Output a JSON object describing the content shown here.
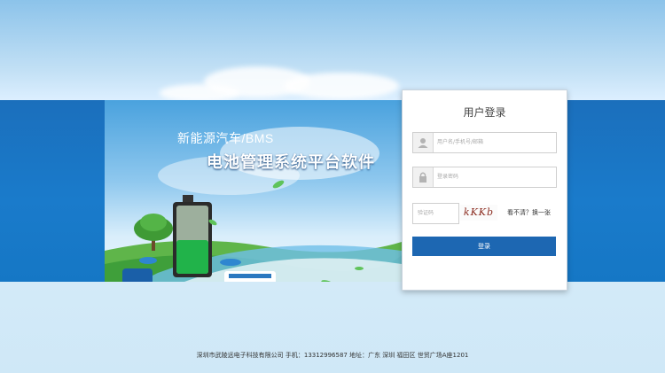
{
  "banner": {
    "subtitle": "新能源汽车/BMS",
    "title": "电池管理系统平台软件"
  },
  "login": {
    "title": "用户登录",
    "username_placeholder": "用户名/手机号/邮箱",
    "password_placeholder": "登录密码",
    "captcha_placeholder": "验证码",
    "captcha_text": "kKKb",
    "refresh_label": "看不清？换一张",
    "submit_label": "登录"
  },
  "footer": {
    "text": "深圳市武陵远电子科技有限公司 手机：13312996587 地址：广东 深圳 福田区 世贸广场A座1201"
  },
  "colors": {
    "band": "#1b6fbc",
    "button": "#1d67b2",
    "sky": "#8cc3ea"
  },
  "icons": {
    "username": "user-icon",
    "password": "lock-icon"
  }
}
